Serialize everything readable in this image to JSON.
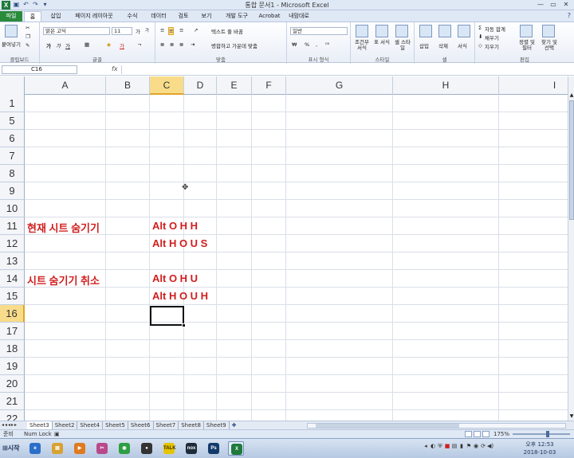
{
  "window": {
    "title": "통합 문서1 - Microsoft Excel",
    "app_icon": "X",
    "qat": [
      "save-icon",
      "undo-icon",
      "redo-icon",
      "customize-icon"
    ],
    "controls": [
      "minimize-icon",
      "maximize-icon",
      "close-icon"
    ]
  },
  "ribbon_tabs": [
    {
      "label": "파일",
      "kind": "file"
    },
    {
      "label": "홈",
      "kind": "active"
    },
    {
      "label": "삽입",
      "kind": ""
    },
    {
      "label": "페이지 레이아웃",
      "kind": ""
    },
    {
      "label": "수식",
      "kind": ""
    },
    {
      "label": "데이터",
      "kind": ""
    },
    {
      "label": "검토",
      "kind": ""
    },
    {
      "label": "보기",
      "kind": ""
    },
    {
      "label": "개발 도구",
      "kind": ""
    },
    {
      "label": "Acrobat",
      "kind": ""
    },
    {
      "label": "내맘대로",
      "kind": ""
    }
  ],
  "ribbon": {
    "clipboard": {
      "paste": "붙여넣기",
      "name": "클립보드"
    },
    "font": {
      "face": "맑은 고딕",
      "size": "11",
      "bold": "가",
      "italic": "가",
      "underline": "가",
      "font_color": "가",
      "grow": "가",
      "shrink": "가",
      "name": "글꼴"
    },
    "alignment": {
      "wrap": "텍스트 줄 바꿈",
      "merge": "병합하고 가운데 맞춤",
      "name": "맞춤"
    },
    "number": {
      "format": "일반",
      "percent": "%",
      "comma": ",",
      "name": "표시 형식"
    },
    "styles": {
      "conditional": "조건부 서식",
      "table": "표 서식",
      "cell": "셀 스타일",
      "name": "스타일"
    },
    "cells": {
      "insert": "삽입",
      "delete": "삭제",
      "format": "서식",
      "name": "셀"
    },
    "editing": {
      "autosum": "자동 합계",
      "fill": "채우기",
      "clear": "지우기",
      "sort": "정렬 및 필터",
      "find": "찾기 및 선택",
      "name": "편집"
    }
  },
  "formula_bar": {
    "name_box": "C16",
    "fx": "fx",
    "value": ""
  },
  "columns": [
    {
      "label": "A",
      "active": false
    },
    {
      "label": "B",
      "active": false
    },
    {
      "label": "C",
      "active": true
    },
    {
      "label": "D",
      "active": false
    },
    {
      "label": "E",
      "active": false
    },
    {
      "label": "F",
      "active": false
    },
    {
      "label": "G",
      "active": false
    },
    {
      "label": "H",
      "active": false
    },
    {
      "label": "I",
      "active": false
    }
  ],
  "rows": [
    {
      "label": "1",
      "active": false
    },
    {
      "label": "5",
      "active": false
    },
    {
      "label": "6",
      "active": false
    },
    {
      "label": "7",
      "active": false
    },
    {
      "label": "8",
      "active": false
    },
    {
      "label": "9",
      "active": false
    },
    {
      "label": "10",
      "active": false
    },
    {
      "label": "11",
      "active": false
    },
    {
      "label": "12",
      "active": false
    },
    {
      "label": "13",
      "active": false
    },
    {
      "label": "14",
      "active": false
    },
    {
      "label": "15",
      "active": false
    },
    {
      "label": "16",
      "active": true
    },
    {
      "label": "17",
      "active": false
    },
    {
      "label": "18",
      "active": false
    },
    {
      "label": "19",
      "active": false
    },
    {
      "label": "20",
      "active": false
    },
    {
      "label": "21",
      "active": false
    },
    {
      "label": "22",
      "active": false
    }
  ],
  "cells": {
    "a11": "현재 시트 숨기기",
    "c11": "Alt O H H",
    "c12": "Alt H O U S",
    "a14": "시트 숨기기 취소",
    "c14": "Alt O H U",
    "c15": "Alt H O U H"
  },
  "sheets": [
    {
      "label": "Sheet3",
      "active": true
    },
    {
      "label": "Sheet2",
      "active": false
    },
    {
      "label": "Sheet4",
      "active": false
    },
    {
      "label": "Sheet5",
      "active": false
    },
    {
      "label": "Sheet6",
      "active": false
    },
    {
      "label": "Sheet7",
      "active": false
    },
    {
      "label": "Sheet8",
      "active": false
    },
    {
      "label": "Sheet9",
      "active": false
    }
  ],
  "status": {
    "ready": "준비",
    "numlock": "Num Lock",
    "zoom": "175%"
  },
  "taskbar": {
    "start": "시작",
    "apps": [
      {
        "name": "ie-icon",
        "glyph": "e",
        "color": "#2a6fc9",
        "active": false
      },
      {
        "name": "folder-icon",
        "glyph": "▤",
        "color": "#d8a233",
        "active": false
      },
      {
        "name": "media-player-icon",
        "glyph": "▶",
        "color": "#e07a1f",
        "active": false
      },
      {
        "name": "scissors-icon",
        "glyph": "✂",
        "color": "#b84a8c",
        "active": false
      },
      {
        "name": "chrome-icon",
        "glyph": "◉",
        "color": "#2f9e44",
        "active": false
      },
      {
        "name": "obs-icon",
        "glyph": "●",
        "color": "#333333",
        "active": false
      },
      {
        "name": "talk-icon",
        "glyph": "TALK",
        "color": "#e6c400",
        "active": false
      },
      {
        "name": "nox-icon",
        "glyph": "nox",
        "color": "#1d2b3a",
        "active": false
      },
      {
        "name": "photoshop-icon",
        "glyph": "Ps",
        "color": "#123a6b",
        "active": false
      },
      {
        "name": "excel-icon",
        "glyph": "X",
        "color": "#1f7a3c",
        "active": true
      }
    ],
    "clock_time": "오후 12:53",
    "clock_date": "2018-10-03"
  }
}
